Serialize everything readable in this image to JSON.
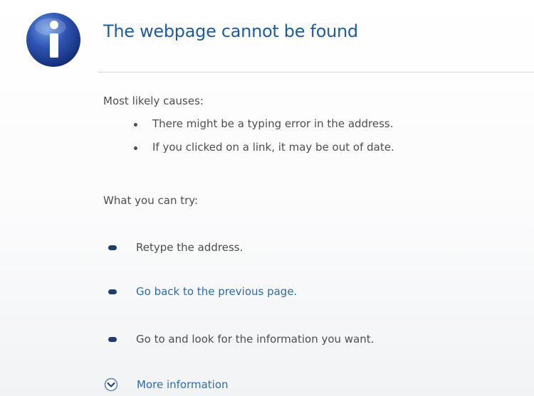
{
  "header": {
    "icon": "info-icon",
    "title": "The webpage cannot be found"
  },
  "causes": {
    "heading": "Most likely causes:",
    "items": [
      "There might be a typing error in the address.",
      "If you clicked on a link, it may be out of date."
    ]
  },
  "try": {
    "heading": "What you can try:",
    "items": [
      {
        "text": "Retype the address.",
        "is_link": false
      },
      {
        "text": "Go back to the previous page.",
        "is_link": true
      },
      {
        "text": "Go to  and look for the information you want.",
        "is_link": false
      }
    ]
  },
  "more_info": {
    "icon": "chevron-down-circle-icon",
    "label": "More information"
  },
  "colors": {
    "title": "#1f5c9c",
    "link": "#2f6aa8",
    "text": "#4d4d4d",
    "icon_blue": "#1f3f8f",
    "bullet": "#1f3d6d"
  }
}
